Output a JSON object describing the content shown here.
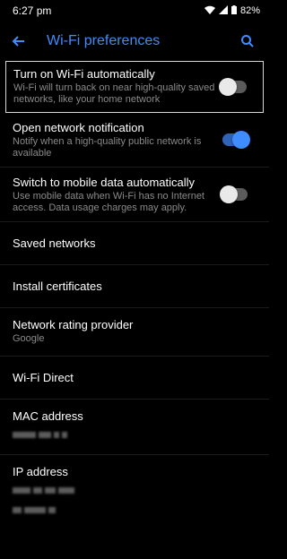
{
  "status_bar": {
    "time": "6:27 pm",
    "battery": "82%"
  },
  "app_bar": {
    "title": "Wi-Fi preferences"
  },
  "settings": [
    {
      "label": "Turn on Wi-Fi automatically",
      "desc": "Wi-Fi will turn back on near high-quality saved networks, like your home network",
      "toggle": false
    },
    {
      "label": "Open network notification",
      "desc": "Notify when a high-quality public network is available",
      "toggle": true
    },
    {
      "label": "Switch to mobile data automatically",
      "desc": "Use mobile data when Wi-Fi has no Internet access. Data usage charges may apply.",
      "toggle": false
    },
    {
      "label": "Saved networks"
    },
    {
      "label": "Install certificates"
    },
    {
      "label": "Network rating provider",
      "desc": "Google"
    },
    {
      "label": "Wi-Fi Direct"
    },
    {
      "label": "MAC address"
    },
    {
      "label": "IP address"
    }
  ],
  "colors": {
    "accent": "#3f8cff",
    "background": "#000000"
  }
}
